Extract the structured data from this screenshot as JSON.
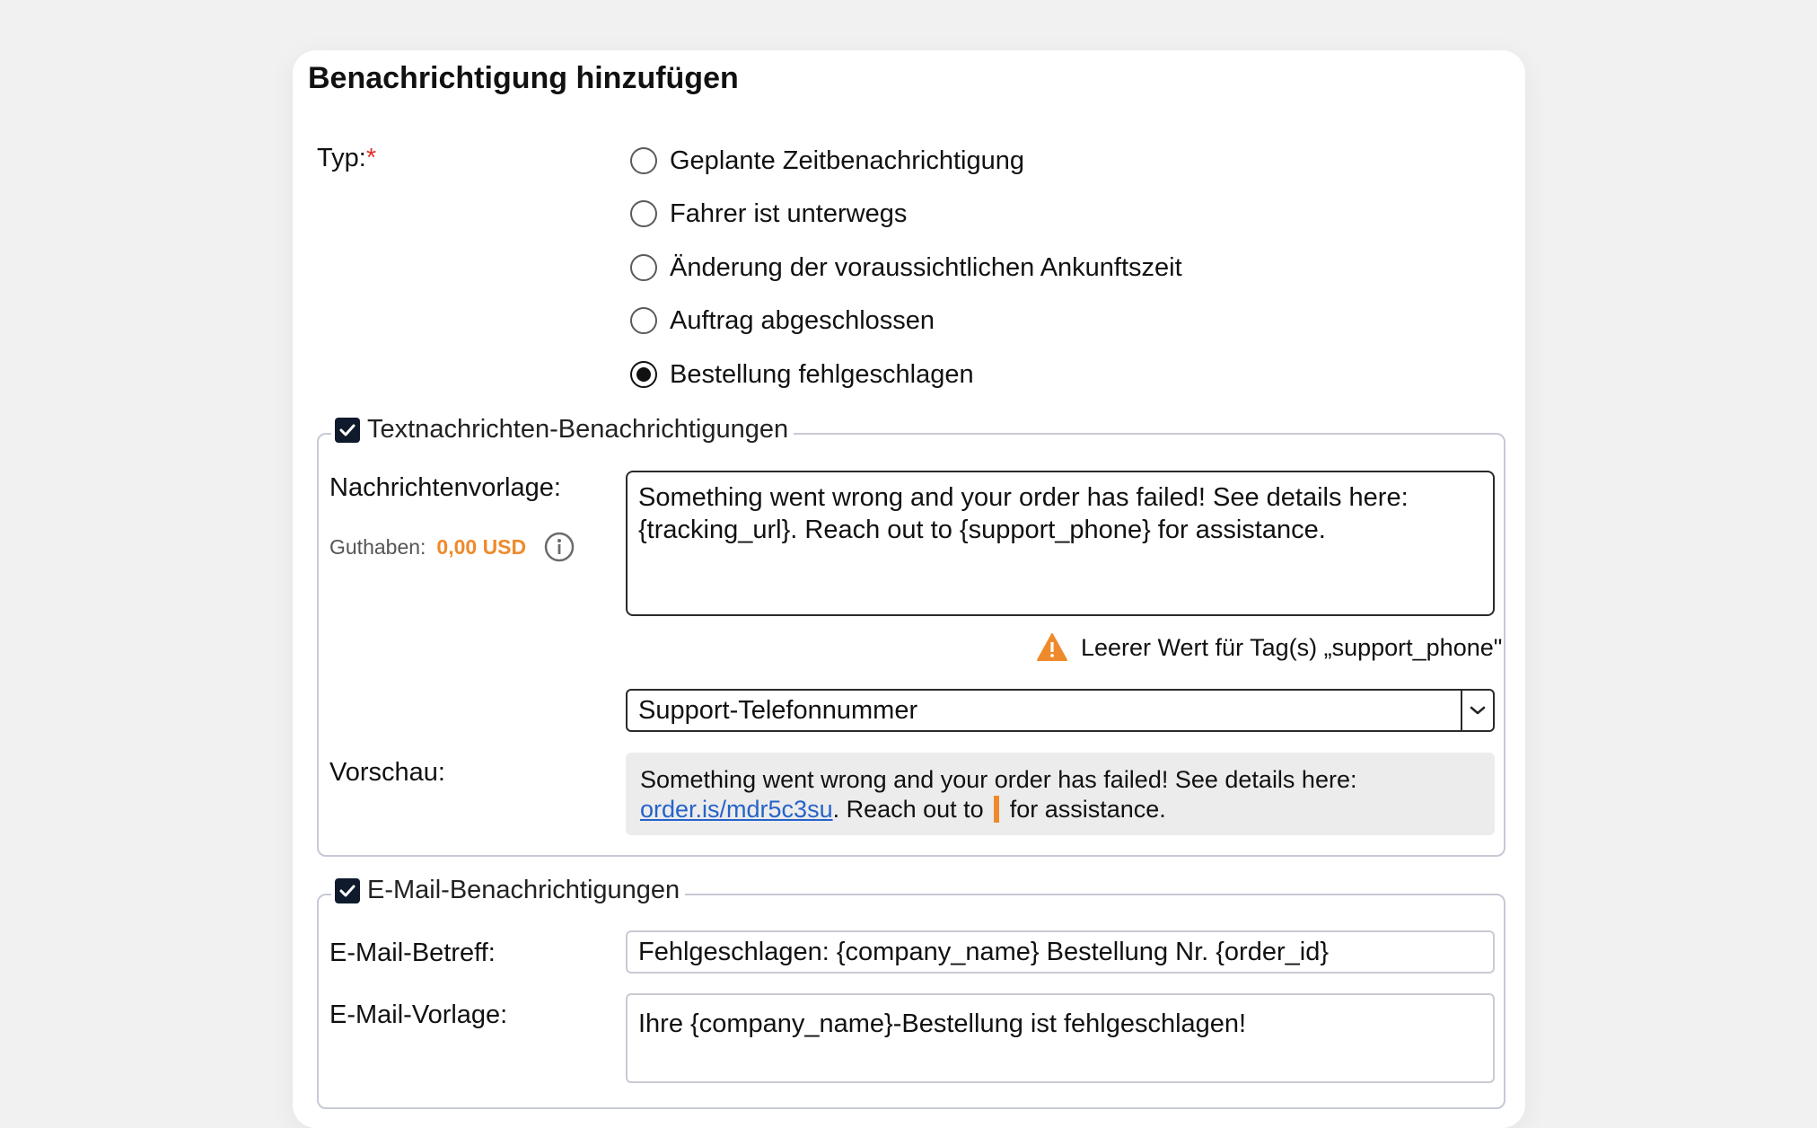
{
  "dialog": {
    "title": "Benachrichtigung hinzufügen"
  },
  "type_field": {
    "label": "Typ:",
    "required_mark": "*",
    "options": [
      {
        "label": "Geplante Zeitbenachrichtigung",
        "checked": false
      },
      {
        "label": "Fahrer ist unterwegs",
        "checked": false
      },
      {
        "label": "Änderung der voraussichtlichen Ankunftszeit",
        "checked": false
      },
      {
        "label": "Auftrag abgeschlossen",
        "checked": false
      },
      {
        "label": "Bestellung fehlgeschlagen",
        "checked": true
      }
    ]
  },
  "sms": {
    "legend": "Textnachrichten-Benachrichtigungen",
    "enabled": true,
    "template_label": "Nachrichtenvorlage:",
    "balance_label": "Guthaben:",
    "balance_value": "0,00 USD",
    "template_value": "Something went wrong and your order has failed! See details here: {tracking_url}. Reach out to {support_phone} for assistance.",
    "warning_text": "Leerer Wert für Tag(s) „support_phone\"",
    "tag_select_value": "Support-Telefonnummer",
    "preview_label": "Vorschau:",
    "preview_before": "Something went wrong and your order has failed! See details here:",
    "preview_link": "order.is/mdr5c3su",
    "preview_middle": ". Reach out to",
    "preview_after": "for assistance."
  },
  "email": {
    "legend": "E-Mail-Benachrichtigungen",
    "enabled": true,
    "subject_label": "E-Mail-Betreff:",
    "subject_value": "Fehlgeschlagen: {company_name} Bestellung Nr. {order_id}",
    "template_label": "E-Mail-Vorlage:",
    "template_value": "Ihre {company_name}-Bestellung ist fehlgeschlagen!"
  },
  "colors": {
    "accent_orange": "#ef8a2c",
    "required_red": "#e0302a",
    "link_blue": "#2563c9",
    "checkbox_navy": "#0f1b2d"
  }
}
